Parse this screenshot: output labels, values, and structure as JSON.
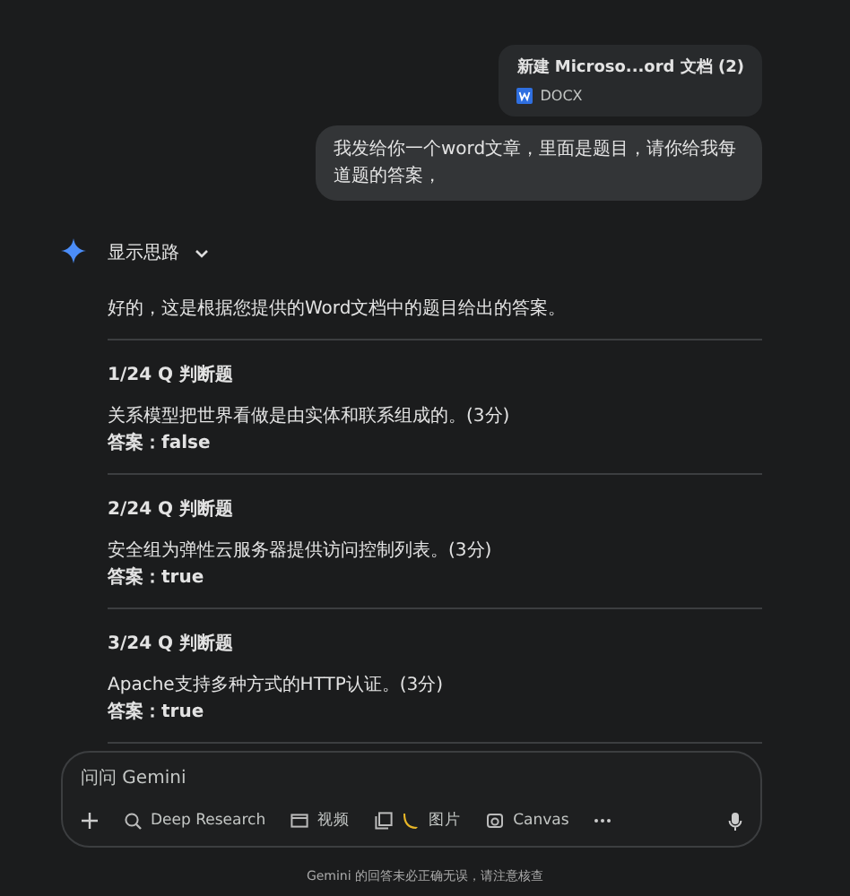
{
  "attachment": {
    "name": "新建 Microso...ord 文档 (2)",
    "type": "DOCX"
  },
  "user_message": "我发给你一个word文章，里面是题目，请你给我每道题的答案，",
  "response": {
    "thoughts_label": "显示思路",
    "thoughts_expanded": false,
    "intro": "好的，这是根据您提供的Word文档中的题目给出的答案。",
    "questions": [
      {
        "title": "1/24 Q 判断题",
        "text": "关系模型把世界看做是由实体和联系组成的。(3分)",
        "answer_label": "答案：",
        "answer": "false"
      },
      {
        "title": "2/24 Q 判断题",
        "text": "安全组为弹性云服务器提供访问控制列表。(3分)",
        "answer_label": "答案：",
        "answer": "true"
      },
      {
        "title": "3/24 Q 判断题",
        "text": "Apache支持多种方式的HTTP认证。(3分)",
        "answer_label": "答案：",
        "answer": "true"
      }
    ]
  },
  "input": {
    "placeholder": "问问 Gemini",
    "tools": [
      {
        "kind": "research",
        "label": "Deep Research"
      },
      {
        "kind": "video",
        "label": "视频"
      },
      {
        "kind": "image",
        "label": "图片"
      },
      {
        "kind": "canvas",
        "label": "Canvas"
      }
    ]
  },
  "disclaimer": "Gemini 的回答未必正确无误，请注意核查"
}
